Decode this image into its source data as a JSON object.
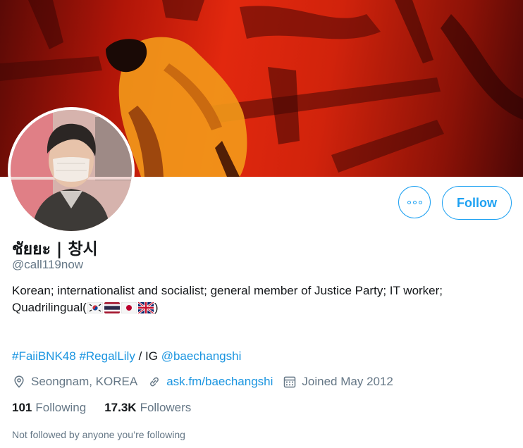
{
  "profile": {
    "display_name": "ชัยยะ | 창시",
    "handle": "@call119now",
    "bio_text": "Korean; internationalist and socialist; general member of Justice Party; IT worker;",
    "bio_languages_label": "Quadrilingual(",
    "bio_languages_close": ")",
    "language_flags": [
      "south-korea-flag-icon",
      "thailand-flag-icon",
      "japan-flag-icon",
      "uk-flag-icon"
    ],
    "hashtags": [
      "#FaiiBNK48",
      "#RegalLily"
    ],
    "ig_separator": " / IG ",
    "ig_mention": "@baechangshi",
    "location": "Seongnam, KOREA",
    "website": "ask.fm/baechangshi",
    "joined": "Joined May 2012",
    "following_count": "101",
    "following_label": "Following",
    "followers_count": "17.3K",
    "followers_label": "Followers",
    "followers_you_know": "Not followed by anyone you’re following"
  },
  "actions": {
    "more_icon": "more-icon",
    "follow_label": "Follow"
  },
  "colors": {
    "accent": "#1da1f2",
    "link": "#1b95e0",
    "secondary_text": "#657786",
    "banner_red": "#e2280e"
  }
}
